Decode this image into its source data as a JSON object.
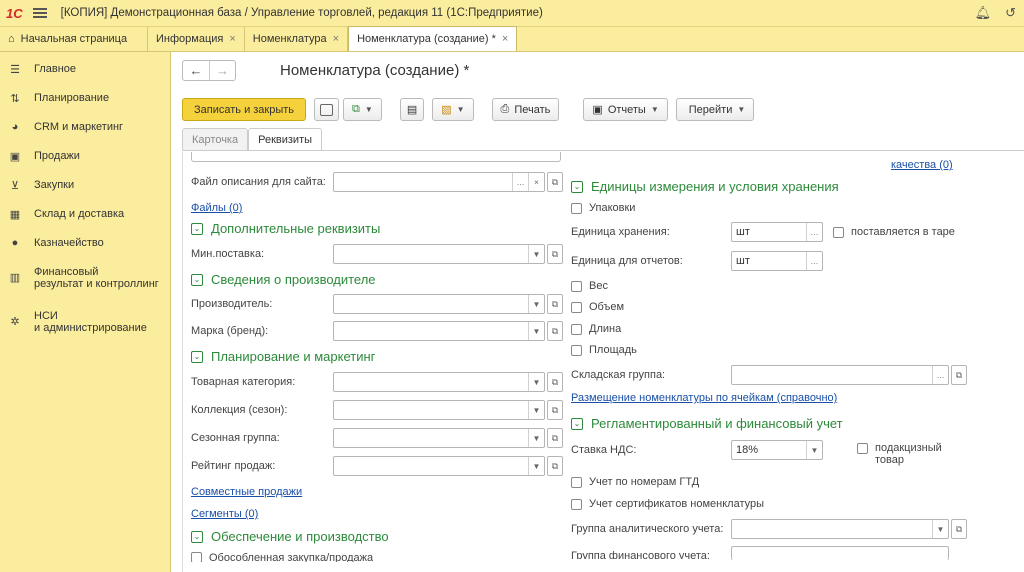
{
  "titlebar": {
    "logo": "1С",
    "title": "[КОПИЯ] Демонстрационная база / Управление торговлей, редакция 11  (1С:Предприятие)"
  },
  "tabs": [
    {
      "label": "Начальная страница",
      "closable": false
    },
    {
      "label": "Информация",
      "closable": true
    },
    {
      "label": "Номенклатура",
      "closable": true
    },
    {
      "label": "Номенклатура (создание) *",
      "closable": true
    }
  ],
  "sidebar": {
    "items": [
      {
        "label": "Главное",
        "icon": "list-icon"
      },
      {
        "label": "Планирование",
        "icon": "planning-icon"
      },
      {
        "label": "CRM и маркетинг",
        "icon": "pie-chart-icon"
      },
      {
        "label": "Продажи",
        "icon": "bag-icon"
      },
      {
        "label": "Закупки",
        "icon": "cart-icon"
      },
      {
        "label": "Склад и доставка",
        "icon": "warehouse-icon"
      },
      {
        "label": "Казначейство",
        "icon": "coin-icon"
      },
      {
        "label1": "Финансовый",
        "label2": "результат и контроллинг",
        "icon": "bar-chart-icon"
      },
      {
        "label1": "НСИ",
        "label2": "и администрирование",
        "icon": "gear-icon"
      }
    ]
  },
  "form": {
    "title": "Номенклатура (создание) *",
    "toolbar": {
      "save_close": "Записать и закрыть",
      "print": "Печать",
      "reports": "Отчеты",
      "goto": "Перейти"
    },
    "tabs": [
      "Карточка",
      "Реквизиты"
    ],
    "left": {
      "site_file_label": "Файл описания для сайта:",
      "files_link": "Файлы (0)",
      "sec_additional": "Дополнительные реквизиты",
      "min_supply_label": "Мин.поставка:",
      "sec_manufacturer": "Сведения о производителе",
      "manufacturer_label": "Производитель:",
      "brand_label": "Марка (бренд):",
      "sec_planning": "Планирование и маркетинг",
      "category_label": "Товарная категория:",
      "collection_label": "Коллекция (сезон):",
      "season_group_label": "Сезонная группа:",
      "rating_label": "Рейтинг продаж:",
      "joint_sales_link": "Совместные продажи",
      "segments_link": "Сегменты (0)",
      "sec_supply": "Обеспечение и производство",
      "cut_text": "Обособленная закупка/продажа"
    },
    "right": {
      "quality_link": "качества (0)",
      "sec_units": "Единицы измерения и условия хранения",
      "packages_cb": "Упаковки",
      "storage_unit_label": "Единица хранения:",
      "storage_unit_value": "шт",
      "tare_cb": "поставляется в таре",
      "report_unit_label": "Единица для отчетов:",
      "report_unit_value": "шт",
      "weight_cb": "Вес",
      "volume_cb": "Объем",
      "length_cb": "Длина",
      "area_cb": "Площадь",
      "warehouse_group_label": "Складская группа:",
      "placement_link": "Размещение номенклатуры по ячейкам (справочно)",
      "sec_reg": "Регламентированный и финансовый учет",
      "vat_label": "Ставка НДС:",
      "vat_value": "18%",
      "excise_cb1": "подакцизный",
      "excise_cb2": "товар",
      "gtd_cb": "Учет по номерам ГТД",
      "certs_cb": "Учет сертификатов номенклатуры",
      "analytic_group_label": "Группа аналитического учета:",
      "fin_group_label": "Группа финансового учета:"
    }
  },
  "colors": {
    "bar_bg": "#fbed9e",
    "primary_btn": "#f5d13b",
    "section_green": "#2c8a3a",
    "link_blue": "#1a4fa8"
  }
}
